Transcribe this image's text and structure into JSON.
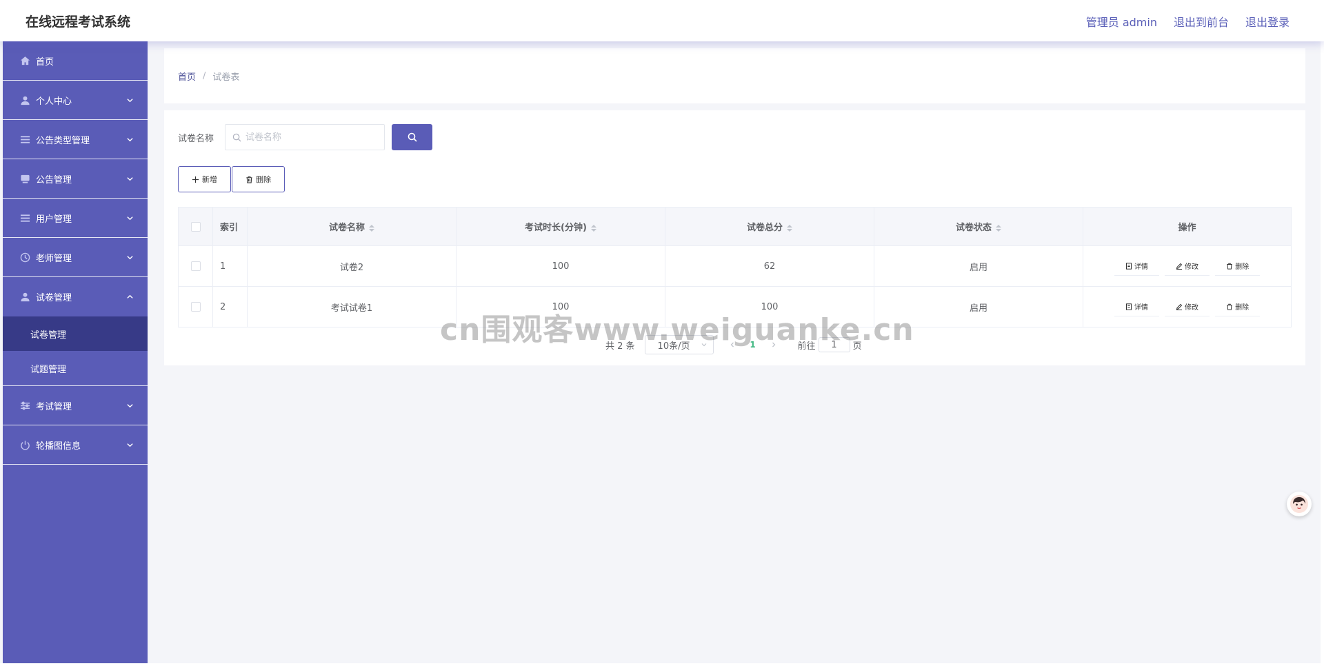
{
  "header": {
    "app_title": "在线远程考试系统",
    "admin_label": "管理员 admin",
    "front_link": "退出到前台",
    "logout_link": "退出登录"
  },
  "sidebar": {
    "items": [
      {
        "label": "首页",
        "icon": "home-icon"
      },
      {
        "label": "个人中心",
        "icon": "user-icon"
      },
      {
        "label": "公告类型管理",
        "icon": "list-icon"
      },
      {
        "label": "公告管理",
        "icon": "monitor-icon"
      },
      {
        "label": "用户管理",
        "icon": "list-icon"
      },
      {
        "label": "老师管理",
        "icon": "clock-icon"
      },
      {
        "label": "试卷管理",
        "icon": "user-icon"
      },
      {
        "label": "考试管理",
        "icon": "sliders-icon"
      },
      {
        "label": "轮播图信息",
        "icon": "power-icon"
      }
    ],
    "submenu": [
      "试卷管理",
      "试题管理"
    ]
  },
  "breadcrumb": {
    "home": "首页",
    "separator": "/",
    "current": "试卷表"
  },
  "search": {
    "label": "试卷名称",
    "placeholder": "试卷名称"
  },
  "toolbar": {
    "add_label": "新增",
    "delete_label": "删除"
  },
  "table": {
    "headers": [
      "索引",
      "试卷名称",
      "考试时长(分钟)",
      "试卷总分",
      "试卷状态",
      "操作"
    ],
    "rows": [
      {
        "index": "1",
        "name": "试卷2",
        "duration": "100",
        "score": "62",
        "status": "启用"
      },
      {
        "index": "2",
        "name": "考试试卷1",
        "duration": "100",
        "score": "100",
        "status": "启用"
      }
    ],
    "ops": {
      "detail": "详情",
      "edit": "修改",
      "delete": "删除"
    }
  },
  "pagination": {
    "total": "共 2 条",
    "page_size": "10条/页",
    "current_page": "1",
    "goto_label": "前往",
    "goto_value": "1",
    "page_suffix": "页"
  },
  "watermark": "cn围观客www.weiguanke.cn",
  "colors": {
    "accent": "#5a5cb7",
    "sidebar_active": "#373a87",
    "page_active": "#41b883"
  }
}
